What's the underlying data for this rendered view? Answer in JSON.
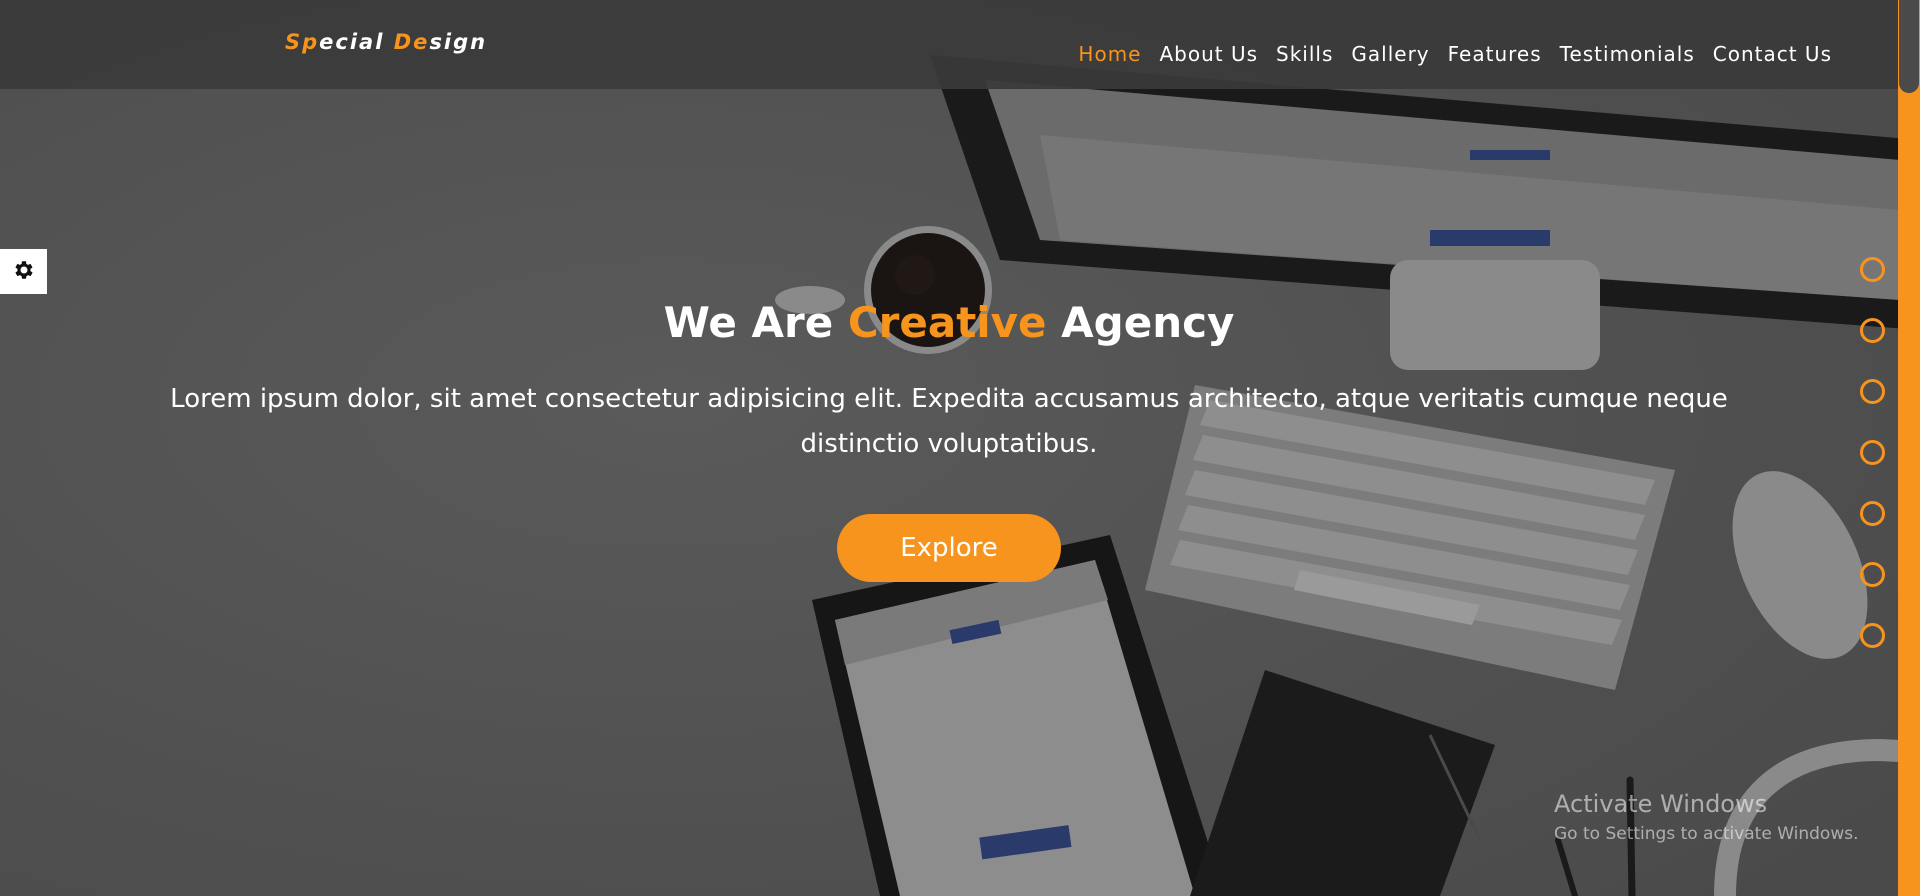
{
  "header": {
    "logo": {
      "parts": [
        {
          "text": "Sp",
          "highlight": true
        },
        {
          "text": "ecial ",
          "highlight": false
        },
        {
          "text": "De",
          "highlight": true
        },
        {
          "text": "sign",
          "highlight": false
        }
      ]
    },
    "nav": [
      {
        "label": "Home",
        "active": true
      },
      {
        "label": "About Us",
        "active": false
      },
      {
        "label": "Skills",
        "active": false
      },
      {
        "label": "Gallery",
        "active": false
      },
      {
        "label": "Features",
        "active": false
      },
      {
        "label": "Testimonials",
        "active": false
      },
      {
        "label": "Contact Us",
        "active": false
      }
    ]
  },
  "settings": {
    "icon": "gear-icon"
  },
  "hero": {
    "title_before": "We Are ",
    "title_highlight": "Creative",
    "title_after": " Agency",
    "description": "Lorem ipsum dolor, sit amet consectetur adipisicing elit. Expedita accusamus architecto, atque veritatis cumque neque distinctio voluptatibus.",
    "button_label": "Explore"
  },
  "bullets": {
    "count": 7
  },
  "watermark": {
    "line1": "Activate Windows",
    "line2": "Go to Settings to activate Windows."
  },
  "colors": {
    "accent": "#f7941d",
    "header_bg": "#3a3a3a",
    "text": "#ffffff"
  }
}
